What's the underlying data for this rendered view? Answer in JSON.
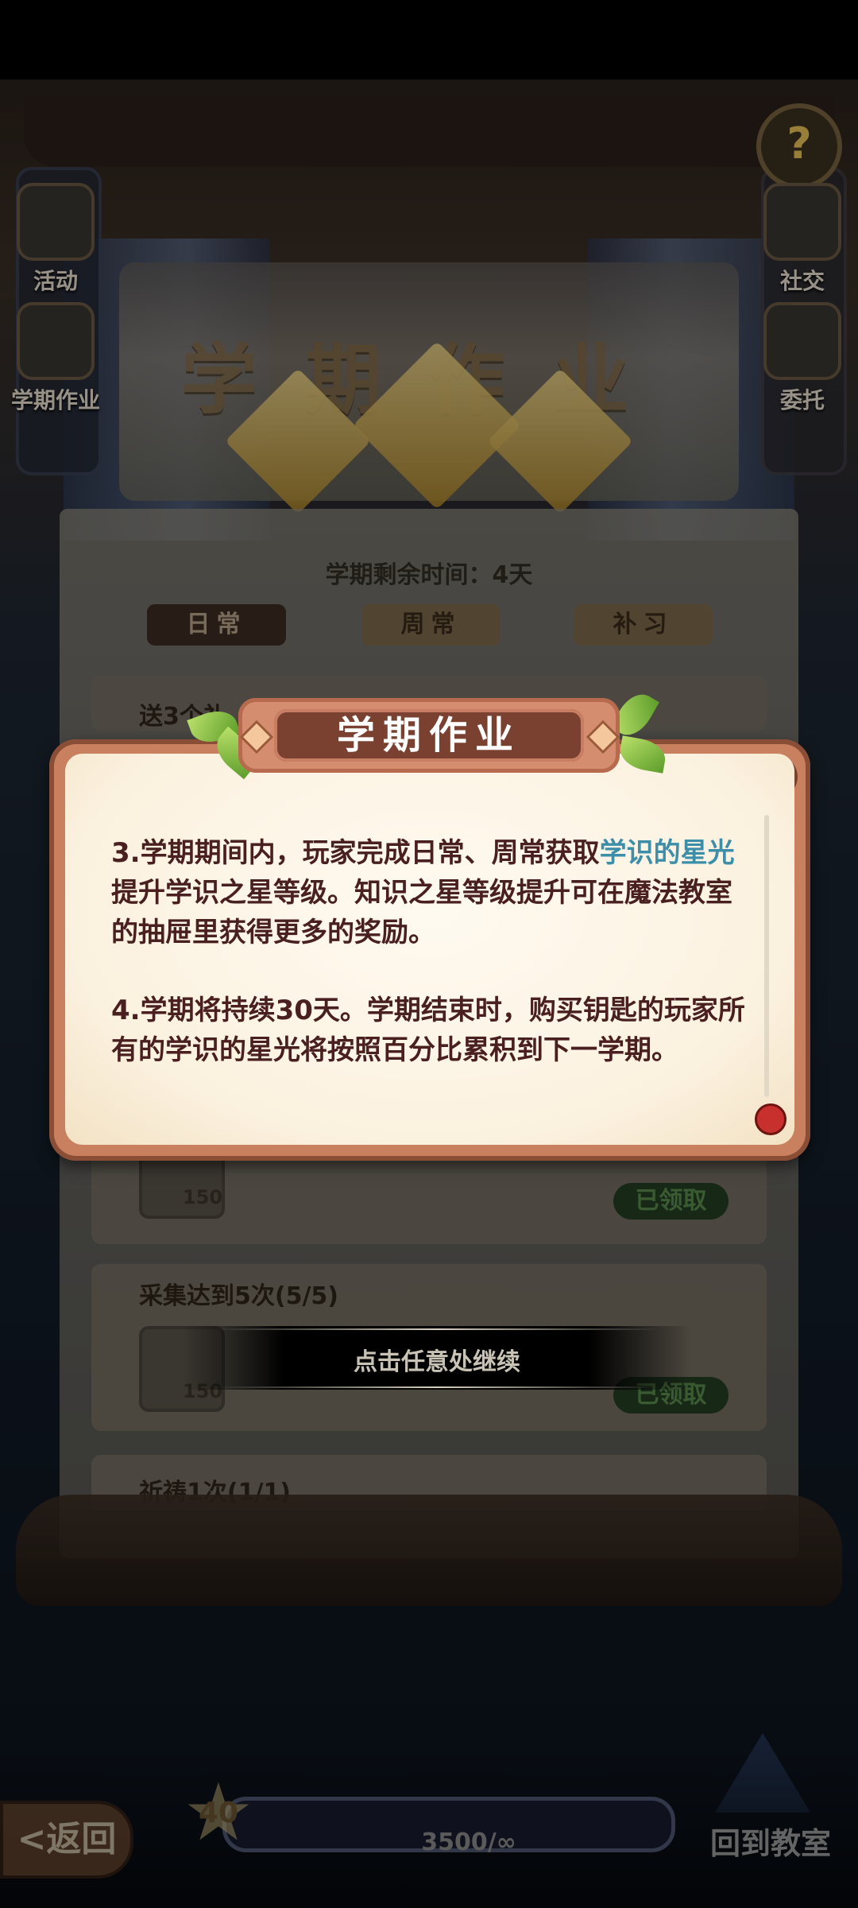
{
  "side_left": [
    {
      "label": "活动",
      "icon": "event-flag-icon"
    },
    {
      "label": "学期作业",
      "icon": "homework-scroll-icon"
    }
  ],
  "side_right": [
    {
      "label": "社交",
      "icon": "social-icon"
    },
    {
      "label": "委托",
      "icon": "commission-icon"
    }
  ],
  "help_glyph": "?",
  "board": {
    "title": "学期作业",
    "remaining_time": "学期剩余时间：4天",
    "tabs": [
      "日常",
      "周常",
      "补习"
    ],
    "tasks": [
      {
        "title": "送3个礼",
        "reward": "150",
        "status": "已领取"
      },
      {
        "title": "采集达到5次(5/5)",
        "reward": "150",
        "status": "已领取"
      },
      {
        "title": "祈祷1次(1/1)"
      }
    ]
  },
  "dialog": {
    "title": "学期作业",
    "p1_before": "3.学期期间内，玩家完成日常、周常获取",
    "p1_highlight": "学识的星光",
    "p1_after": "提升学识之星等级。知识之星等级提升可在魔法教室的抽屉里获得更多的奖励。",
    "p2": "4.学期将持续30天。学期结束时，购买钥匙的玩家所有的学识的星光将按照百分比累积到下一学期。",
    "highlight_color": "#3d8fa9"
  },
  "continue_hint": "点击任意处继续",
  "bottom": {
    "back_label": "<返回",
    "level": "40",
    "progress_text": "3500/∞",
    "home_label": "回到教室"
  }
}
